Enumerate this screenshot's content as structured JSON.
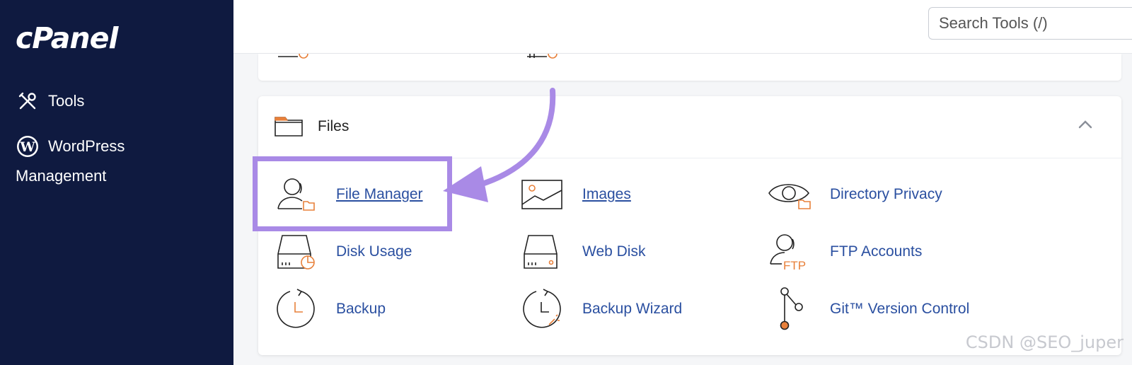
{
  "sidebar": {
    "logo": "cPanel",
    "items": [
      {
        "label": "Tools",
        "icon": "tools-icon"
      },
      {
        "label": "WordPress",
        "icon": "wordpress-icon"
      }
    ],
    "wp_sub": "Management"
  },
  "header": {
    "search_placeholder": "Search Tools (/)"
  },
  "files_panel": {
    "title": "Files",
    "tools": [
      {
        "label": "File Manager",
        "icon": "file-manager-icon"
      },
      {
        "label": "Images",
        "icon": "images-icon"
      },
      {
        "label": "Directory Privacy",
        "icon": "directory-privacy-icon"
      },
      {
        "label": "Disk Usage",
        "icon": "disk-usage-icon"
      },
      {
        "label": "Web Disk",
        "icon": "web-disk-icon"
      },
      {
        "label": "FTP Accounts",
        "icon": "ftp-accounts-icon"
      },
      {
        "label": "Backup",
        "icon": "backup-icon"
      },
      {
        "label": "Backup Wizard",
        "icon": "backup-wizard-icon"
      },
      {
        "label": "Git™ Version Control",
        "icon": "git-icon"
      }
    ]
  },
  "colors": {
    "sidebar_bg": "#0f1a40",
    "link": "#2a4fa0",
    "accent": "#e8803a",
    "highlight": "#a98ae6"
  },
  "watermark": "CSDN @SEO_juper"
}
